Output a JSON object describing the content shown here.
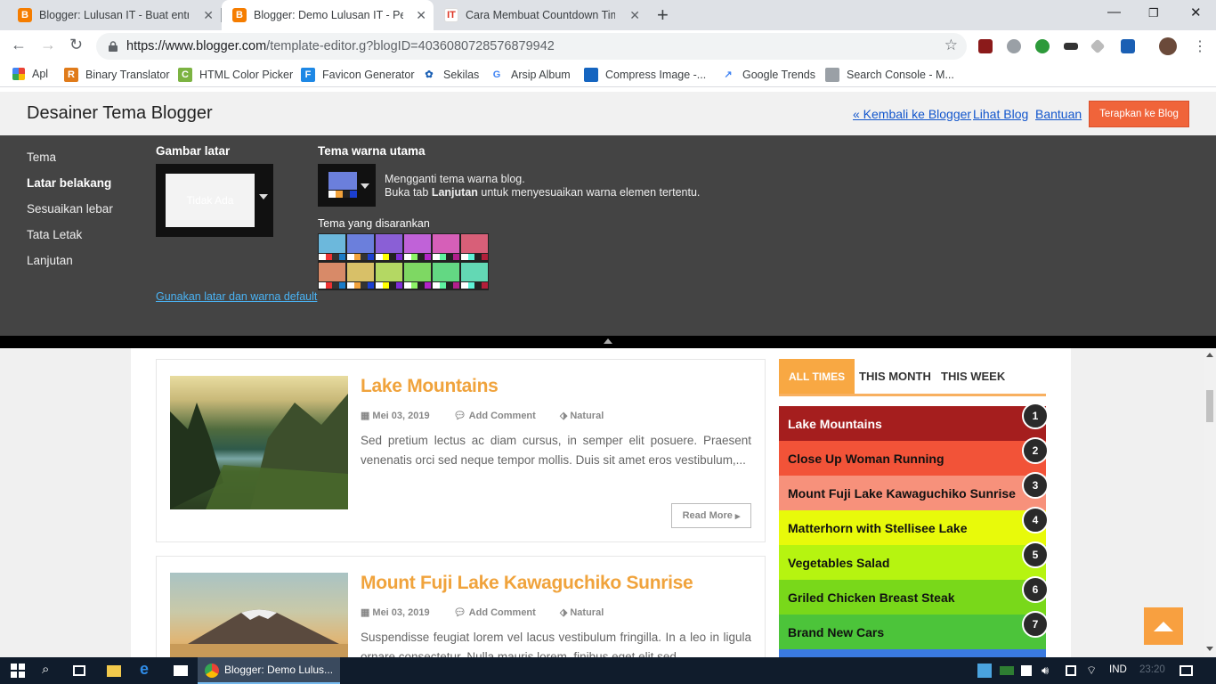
{
  "browser": {
    "tabs": [
      {
        "title": "Blogger: Lulusan IT - Buat entri",
        "favicon": "blogger-icon"
      },
      {
        "title": "Blogger: Demo Lulusan IT - Pera",
        "favicon": "blogger-icon",
        "active": true
      },
      {
        "title": "Cara Membuat Countdown Time",
        "favicon": "it-icon"
      }
    ],
    "url_host": "https://www.blogger.com",
    "url_path": "/template-editor.g?blogID=4036080728576879942",
    "bookmarks": [
      "Apl",
      "Binary Translator",
      "HTML Color Picker",
      "Favicon Generator",
      "Sekilas",
      "Arsip Album",
      "Compress Image -...",
      "Google Trends",
      "Search Console - M..."
    ]
  },
  "designer": {
    "title": "Desainer Tema Blogger",
    "links": [
      "« Kembali ke Blogger",
      "Lihat Blog",
      "Bantuan"
    ],
    "apply_label": "Terapkan ke Blog",
    "sidebar": [
      {
        "label": "Tema"
      },
      {
        "label": "Latar belakang",
        "selected": true
      },
      {
        "label": "Sesuaikan lebar"
      },
      {
        "label": "Tata Letak"
      },
      {
        "label": "Lanjutan"
      }
    ],
    "bg_label": "Gambar latar",
    "bg_value": "Tidak Ada",
    "theme_label": "Tema warna utama",
    "theme_desc_1": "Mengganti tema warna blog.",
    "theme_desc_2a": "Buka tab ",
    "theme_desc_2b": "Lanjutan",
    "theme_desc_2c": " untuk menyesuaikan warna elemen tertentu.",
    "suggested_label": "Tema yang disarankan",
    "default_link": "Gunakan latar dan warna default",
    "current_theme_color": "#6b7fdc",
    "suggested_colors": [
      "#6cb8dc",
      "#6b7fdc",
      "#8a5fd6",
      "#c062d8",
      "#d65fb8",
      "#d85f78",
      "#d88a68",
      "#d8c068",
      "#b4d863",
      "#7ed863",
      "#63d883",
      "#63d8b4"
    ]
  },
  "posts": [
    {
      "title": "Lake Mountains",
      "date": "Mei 03, 2019",
      "comment": "Add Comment",
      "tag": "Natural",
      "excerpt": "Sed pretium lectus ac diam cursus, in semper elit posuere. Praesent venenatis orci sed neque tempor mollis. Duis sit amet eros vestibulum,...",
      "read_more": "Read More"
    },
    {
      "title": "Mount Fuji Lake Kawaguchiko Sunrise",
      "date": "Mei 03, 2019",
      "comment": "Add Comment",
      "tag": "Natural",
      "excerpt": "Suspendisse feugiat lorem vel lacus vestibulum fringilla. In a leo in ligula ornare consectetur. Nulla mauris lorem, finibus eget elit sed..."
    }
  ],
  "popular": {
    "tabs": [
      "ALL TIMES",
      "THIS MONTH",
      "THIS WEEK"
    ],
    "items": [
      {
        "rank": "1",
        "title": "Lake Mountains",
        "color": "#a51e1e"
      },
      {
        "rank": "2",
        "title": "Close Up Woman Running",
        "color": "#f25338"
      },
      {
        "rank": "3",
        "title": "Mount Fuji Lake Kawaguchiko Sunrise",
        "color": "#f7917b"
      },
      {
        "rank": "4",
        "title": "Matterhorn with Stellisee Lake",
        "color": "#e8fa0a"
      },
      {
        "rank": "5",
        "title": "Vegetables Salad",
        "color": "#b6f410"
      },
      {
        "rank": "6",
        "title": "Griled Chicken Breast Steak",
        "color": "#79d81a"
      },
      {
        "rank": "7",
        "title": "Brand New Cars",
        "color": "#4cc43a"
      }
    ]
  },
  "taskbar": {
    "app_label": "Blogger: Demo Lulus...",
    "lang": "IND",
    "time": "23:20"
  }
}
